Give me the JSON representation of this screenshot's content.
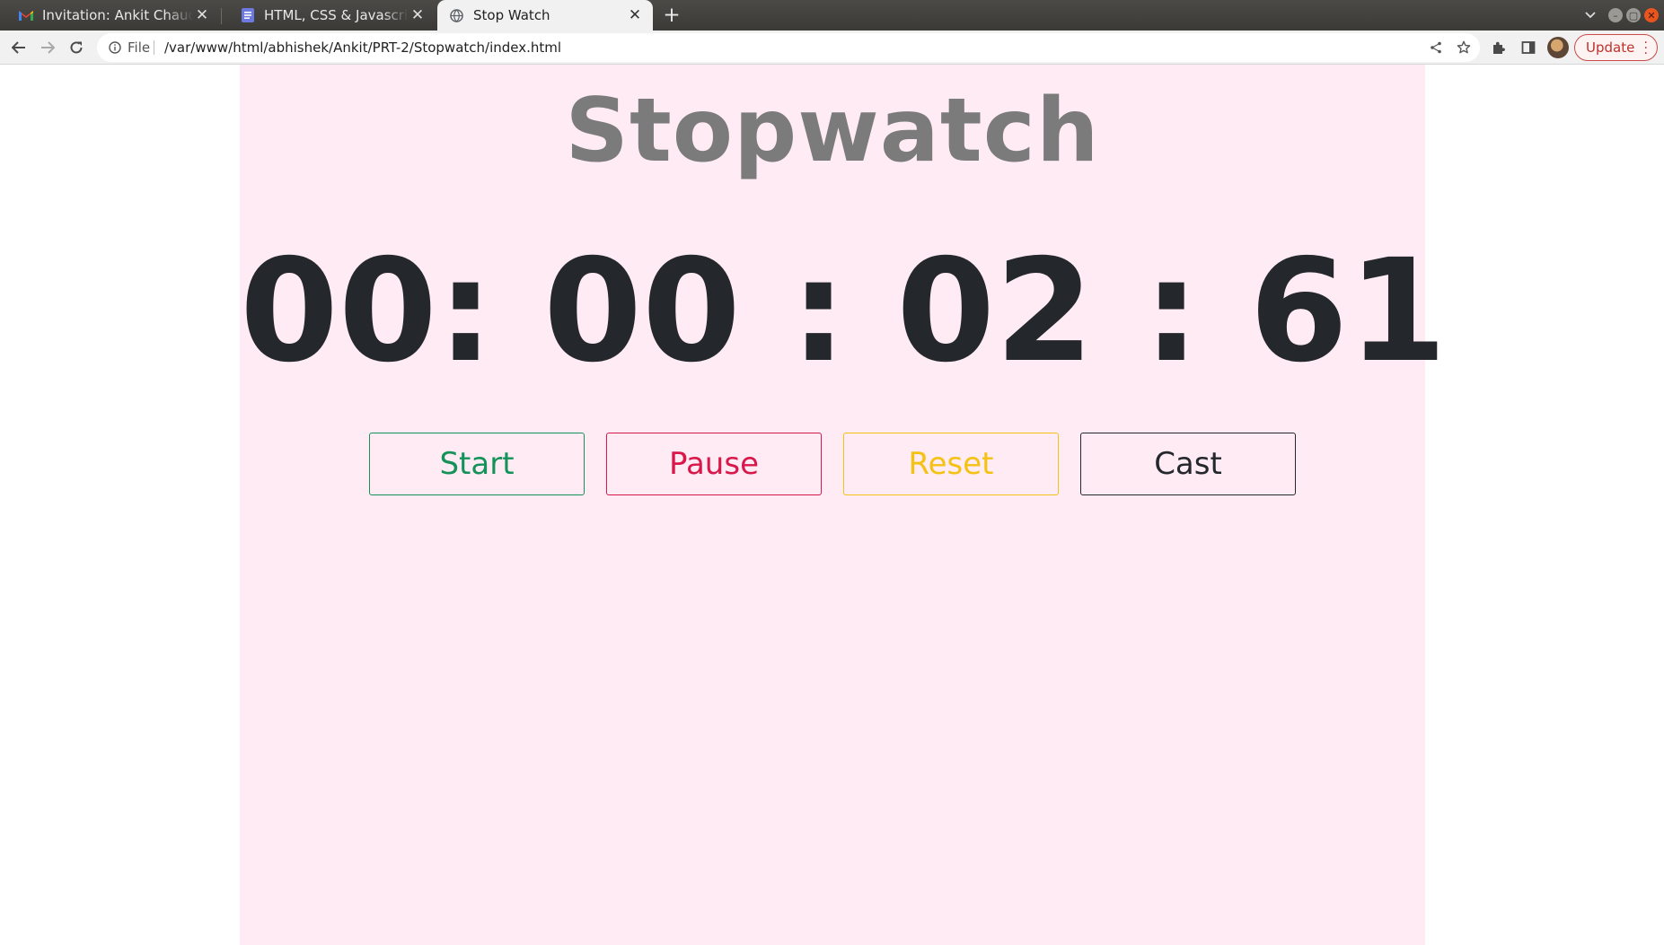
{
  "browser": {
    "tabs": [
      {
        "title": "Invitation: Ankit Chaudha",
        "favicon": "gmail-icon",
        "active": false
      },
      {
        "title": "HTML, CSS & Javascript - S",
        "favicon": "docs-icon",
        "active": false
      },
      {
        "title": "Stop Watch",
        "favicon": "globe-icon",
        "active": true
      }
    ],
    "address_scheme": "File",
    "address_url": "/var/www/html/abhishek/Ankit/PRT-2/Stopwatch/index.html",
    "update_label": "Update"
  },
  "page": {
    "heading": "Stopwatch",
    "timer": {
      "hours": "00:",
      "minutes": "00",
      "sep1": ":",
      "seconds": "02",
      "sep2": ":",
      "centiseconds": "61"
    },
    "buttons": {
      "start": "Start",
      "pause": "Pause",
      "reset": "Reset",
      "cast": "Cast"
    }
  },
  "colors": {
    "panel_background": "#ffebf3",
    "heading": "#7b7b7b",
    "timer": "#24272b",
    "start": "#14925a",
    "pause": "#d8174a",
    "reset": "#f5c214",
    "cast": "#24272b"
  }
}
